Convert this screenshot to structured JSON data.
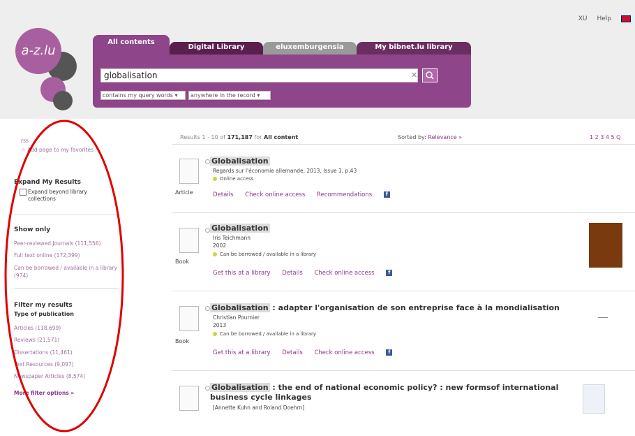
{
  "header": {
    "toplinks": [
      "XU",
      "Help"
    ],
    "logo_text": "a-z.lu",
    "tabs": [
      "All contents",
      "Digital Library",
      "eluxemburgensia",
      "My bibnet.lu library"
    ],
    "search_value": "globalisation",
    "search_scope": "contains my query words",
    "search_field": "anywhere in the record"
  },
  "sidebar": {
    "top_links": [
      "rss",
      "Add page to my favorites"
    ],
    "expand_title": "Expand My Results",
    "expand_checkbox": "Expand beyond library collections",
    "show_only_title": "Show only",
    "show_only": [
      {
        "label": "Peer-reviewed Journals",
        "count": "(111,556)"
      },
      {
        "label": "Full text online",
        "count": "(172,399)"
      },
      {
        "label": "Can be borrowed / available in a library",
        "count": "(974)"
      }
    ],
    "filter_title": "Filter my results",
    "filter_sub": "Type of publication",
    "filters": [
      {
        "label": "Articles",
        "count": "(118,699)"
      },
      {
        "label": "Reviews",
        "count": "(21,571)"
      },
      {
        "label": "Dissertations",
        "count": "(11,461)"
      },
      {
        "label": "Text Resources",
        "count": "(9,097)"
      },
      {
        "label": "Newspaper Articles",
        "count": "(8,574)"
      }
    ],
    "more": "More filter options »"
  },
  "results_bar": {
    "prefix": "Results 1 - 10 of",
    "total": "171,187",
    "for_text": "for",
    "scope": "All content",
    "sorted_label": "Sorted by:",
    "sorted_value": "Relevance »",
    "pages": "1 2 3 4 5 Q"
  },
  "results": [
    {
      "type": "Article",
      "title_hl": "Globalisation",
      "title_rest": "",
      "meta": [
        "Regards sur l'économie allemande, 2013, Issue 1, p.43"
      ],
      "availability": "Online access",
      "actions": [
        "Details",
        "Check online access",
        "Recommendations"
      ]
    },
    {
      "type": "Book",
      "title_hl": "Globalisation",
      "title_rest": "",
      "meta": [
        "Iris Teichmann",
        "2002"
      ],
      "availability": "Can be borrowed / available in a library",
      "actions": [
        "Get this at a library",
        "Details",
        "Check online access"
      ]
    },
    {
      "type": "Book",
      "title_hl": "Globalisation",
      "title_rest": " : adapter l'organisation de son entreprise face à la mondialisation",
      "meta": [
        "Christian Pournier",
        "2013"
      ],
      "availability": "Can be borrowed / available in a library",
      "actions": [
        "Get this at a library",
        "Details",
        "Check online access"
      ]
    },
    {
      "type": "",
      "title_hl": "Globalisation",
      "title_rest": " : the end of national economic policy? : new formsof international",
      "title_line2": "business cycle linkages",
      "meta": [
        "[Annette Kuhn and Roland Doehrn]"
      ],
      "availability": "",
      "actions": []
    }
  ],
  "colors": {
    "brand": "#8e4589",
    "tab_dark": "#5a1f4d",
    "tab_grey": "#9a9a9a",
    "annotation": "#e00000"
  }
}
